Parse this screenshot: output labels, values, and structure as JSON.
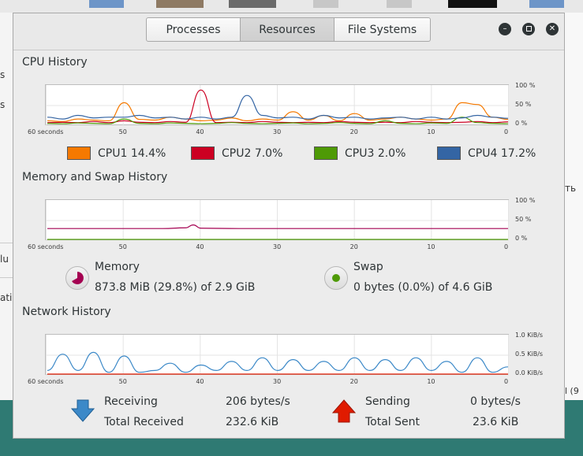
{
  "window": {
    "tabs": [
      "Processes",
      "Resources",
      "File Systems"
    ],
    "active_tab": "Resources"
  },
  "background": {
    "left_texts": [
      "s",
      "s",
      "lu",
      "ati"
    ],
    "right_texts": [
      "ть",
      "l (9"
    ]
  },
  "cpu": {
    "title": "CPU History",
    "x_labels": [
      "60 seconds",
      "50",
      "40",
      "30",
      "20",
      "10",
      "0"
    ],
    "y_labels": [
      "100 %",
      "50 %",
      "0 %"
    ],
    "legend": [
      {
        "label": "CPU1",
        "value": "14.4%",
        "color": "#f57900"
      },
      {
        "label": "CPU2",
        "value": "7.0%",
        "color": "#cc0022"
      },
      {
        "label": "CPU3",
        "value": "2.0%",
        "color": "#4e9a06"
      },
      {
        "label": "CPU4",
        "value": "17.2%",
        "color": "#3465a4"
      }
    ]
  },
  "memory": {
    "title": "Memory and Swap History",
    "x_labels": [
      "60 seconds",
      "50",
      "40",
      "30",
      "20",
      "10",
      "0"
    ],
    "y_labels": [
      "100 %",
      "50 %",
      "0 %"
    ],
    "memory_label": "Memory",
    "memory_value": "873.8 MiB (29.8%) of 2.9 GiB",
    "memory_color": "#a40051",
    "swap_label": "Swap",
    "swap_value": "0 bytes (0.0%) of 4.6 GiB",
    "swap_color": "#4e9a06"
  },
  "network": {
    "title": "Network History",
    "x_labels": [
      "60 seconds",
      "50",
      "40",
      "30",
      "20",
      "10",
      "0"
    ],
    "y_labels": [
      "1.0 KiB/s",
      "0.5 KiB/s",
      "0.0 KiB/s"
    ],
    "receiving_label": "Receiving",
    "receiving_value": "206 bytes/s",
    "total_received_label": "Total Received",
    "total_received_value": "232.6 KiB",
    "sending_label": "Sending",
    "sending_value": "0 bytes/s",
    "total_sent_label": "Total Sent",
    "total_sent_value": "23.6 KiB",
    "receive_color": "#3c89c8",
    "send_color": "#e01b00"
  },
  "chart_data": [
    {
      "type": "line",
      "title": "CPU History",
      "x": [
        60,
        58,
        56,
        54,
        52,
        50,
        48,
        46,
        44,
        42,
        40,
        38,
        36,
        34,
        32,
        30,
        28,
        26,
        24,
        22,
        20,
        18,
        16,
        14,
        12,
        10,
        8,
        6,
        4,
        2,
        0
      ],
      "ylim": [
        0,
        100
      ],
      "series": [
        {
          "name": "CPU1",
          "values": [
            10,
            8,
            15,
            12,
            10,
            60,
            14,
            12,
            20,
            15,
            10,
            12,
            18,
            10,
            15,
            12,
            35,
            12,
            25,
            10,
            30,
            12,
            15,
            20,
            15,
            12,
            15,
            60,
            55,
            20,
            14
          ]
        },
        {
          "name": "CPU2",
          "values": [
            5,
            6,
            5,
            8,
            5,
            10,
            6,
            5,
            8,
            6,
            95,
            5,
            6,
            5,
            8,
            6,
            5,
            6,
            5,
            8,
            6,
            5,
            6,
            5,
            8,
            6,
            5,
            6,
            8,
            5,
            7
          ]
        },
        {
          "name": "CPU3",
          "values": [
            3,
            2,
            4,
            3,
            2,
            15,
            3,
            2,
            4,
            3,
            2,
            3,
            5,
            3,
            2,
            3,
            4,
            2,
            3,
            5,
            3,
            2,
            10,
            3,
            2,
            4,
            3,
            20,
            5,
            3,
            2
          ]
        },
        {
          "name": "CPU4",
          "values": [
            20,
            15,
            25,
            18,
            20,
            20,
            25,
            18,
            20,
            15,
            20,
            15,
            20,
            80,
            25,
            18,
            20,
            15,
            25,
            18,
            20,
            15,
            18,
            20,
            15,
            20,
            15,
            18,
            25,
            20,
            17
          ]
        }
      ]
    },
    {
      "type": "line",
      "title": "Memory and Swap History",
      "x": [
        60,
        55,
        50,
        45,
        42,
        41,
        40,
        35,
        30,
        25,
        20,
        15,
        10,
        5,
        0
      ],
      "ylim": [
        0,
        100
      ],
      "series": [
        {
          "name": "Memory",
          "values": [
            30,
            30,
            30,
            30,
            32,
            40,
            31,
            30,
            30,
            30,
            30,
            30,
            30,
            30,
            30
          ]
        },
        {
          "name": "Swap",
          "values": [
            0,
            0,
            0,
            0,
            0,
            0,
            0,
            0,
            0,
            0,
            0,
            0,
            0,
            0,
            0
          ]
        }
      ]
    },
    {
      "type": "line",
      "title": "Network History",
      "x": [
        60,
        58,
        56,
        54,
        52,
        50,
        48,
        46,
        44,
        42,
        40,
        38,
        36,
        34,
        32,
        30,
        28,
        26,
        24,
        22,
        20,
        18,
        16,
        14,
        12,
        10,
        8,
        6,
        4,
        2,
        0
      ],
      "ylim": [
        0,
        1.0
      ],
      "series": [
        {
          "name": "Receiving",
          "values": [
            0.1,
            0.55,
            0.1,
            0.6,
            0.05,
            0.5,
            0.05,
            0.1,
            0.3,
            0.05,
            0.25,
            0.1,
            0.35,
            0.1,
            0.45,
            0.1,
            0.4,
            0.1,
            0.35,
            0.1,
            0.45,
            0.1,
            0.4,
            0.1,
            0.45,
            0.1,
            0.35,
            0.05,
            0.45,
            0.05,
            0.2
          ]
        },
        {
          "name": "Sending",
          "values": [
            0,
            0,
            0,
            0,
            0,
            0,
            0,
            0,
            0,
            0,
            0,
            0,
            0,
            0,
            0,
            0,
            0,
            0,
            0,
            0,
            0,
            0,
            0,
            0,
            0,
            0,
            0,
            0,
            0,
            0,
            0
          ]
        }
      ]
    }
  ]
}
